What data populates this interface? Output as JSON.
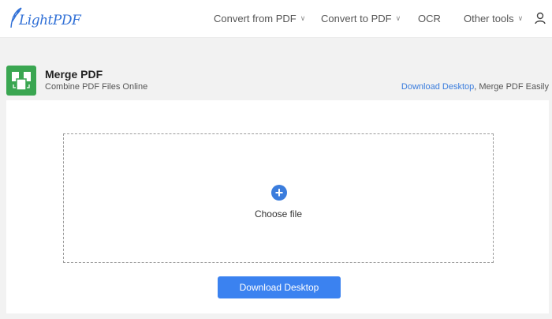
{
  "brand": {
    "logo_text": "LightPDF"
  },
  "nav": {
    "items": [
      {
        "label": "Convert from PDF",
        "has_dropdown": true
      },
      {
        "label": "Convert to PDF",
        "has_dropdown": true
      },
      {
        "label": "OCR",
        "has_dropdown": false
      },
      {
        "label": "Other tools",
        "has_dropdown": true
      }
    ],
    "chevron": "∨"
  },
  "tool": {
    "title": "Merge PDF",
    "subtitle": "Combine PDF Files Online",
    "promo_link": "Download Desktop",
    "promo_rest": ", Merge PDF Easily"
  },
  "upload": {
    "plus": "+",
    "choose_label": "Choose file"
  },
  "actions": {
    "download_label": "Download Desktop"
  },
  "colors": {
    "accent": "#3b82f0",
    "link": "#3b7ddd",
    "tool_icon_bg": "#3aa651"
  },
  "icons": [
    "user-icon",
    "plus-icon",
    "merge-pdf-icon",
    "chevron-down-icon"
  ]
}
